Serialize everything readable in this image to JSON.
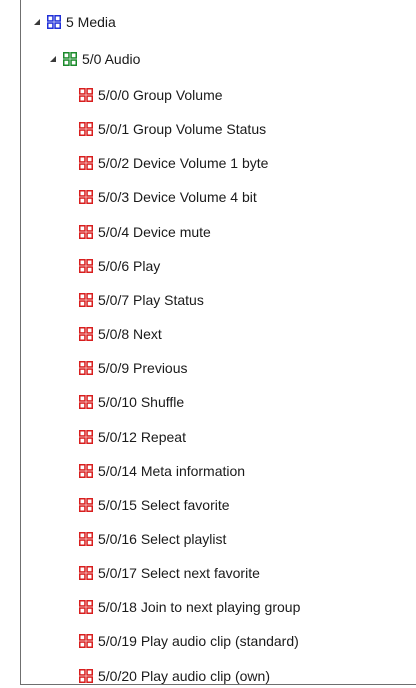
{
  "tree": {
    "main_group": {
      "label": "5 Media",
      "expanded": true,
      "icon": "main-group-icon",
      "icon_color": "#2030d8"
    },
    "middle_group": {
      "label": "5/0 Audio",
      "expanded": true,
      "icon": "middle-group-icon",
      "icon_color": "#1a8a2a"
    },
    "group_addresses": {
      "icon": "group-address-icon",
      "icon_color": "#d81e1e",
      "items": [
        {
          "label": "5/0/0 Group Volume"
        },
        {
          "label": "5/0/1 Group Volume Status"
        },
        {
          "label": "5/0/2 Device Volume 1 byte"
        },
        {
          "label": "5/0/3 Device Volume 4 bit"
        },
        {
          "label": "5/0/4 Device mute"
        },
        {
          "label": "5/0/6 Play"
        },
        {
          "label": "5/0/7 Play Status"
        },
        {
          "label": "5/0/8 Next"
        },
        {
          "label": "5/0/9 Previous"
        },
        {
          "label": "5/0/10 Shuffle"
        },
        {
          "label": "5/0/12 Repeat"
        },
        {
          "label": "5/0/14 Meta information"
        },
        {
          "label": "5/0/15 Select favorite"
        },
        {
          "label": "5/0/16 Select playlist"
        },
        {
          "label": "5/0/17 Select next favorite"
        },
        {
          "label": "5/0/18 Join to next playing group"
        },
        {
          "label": "5/0/19 Play audio clip (standard)"
        },
        {
          "label": "5/0/20 Play audio clip (own)"
        }
      ]
    }
  }
}
